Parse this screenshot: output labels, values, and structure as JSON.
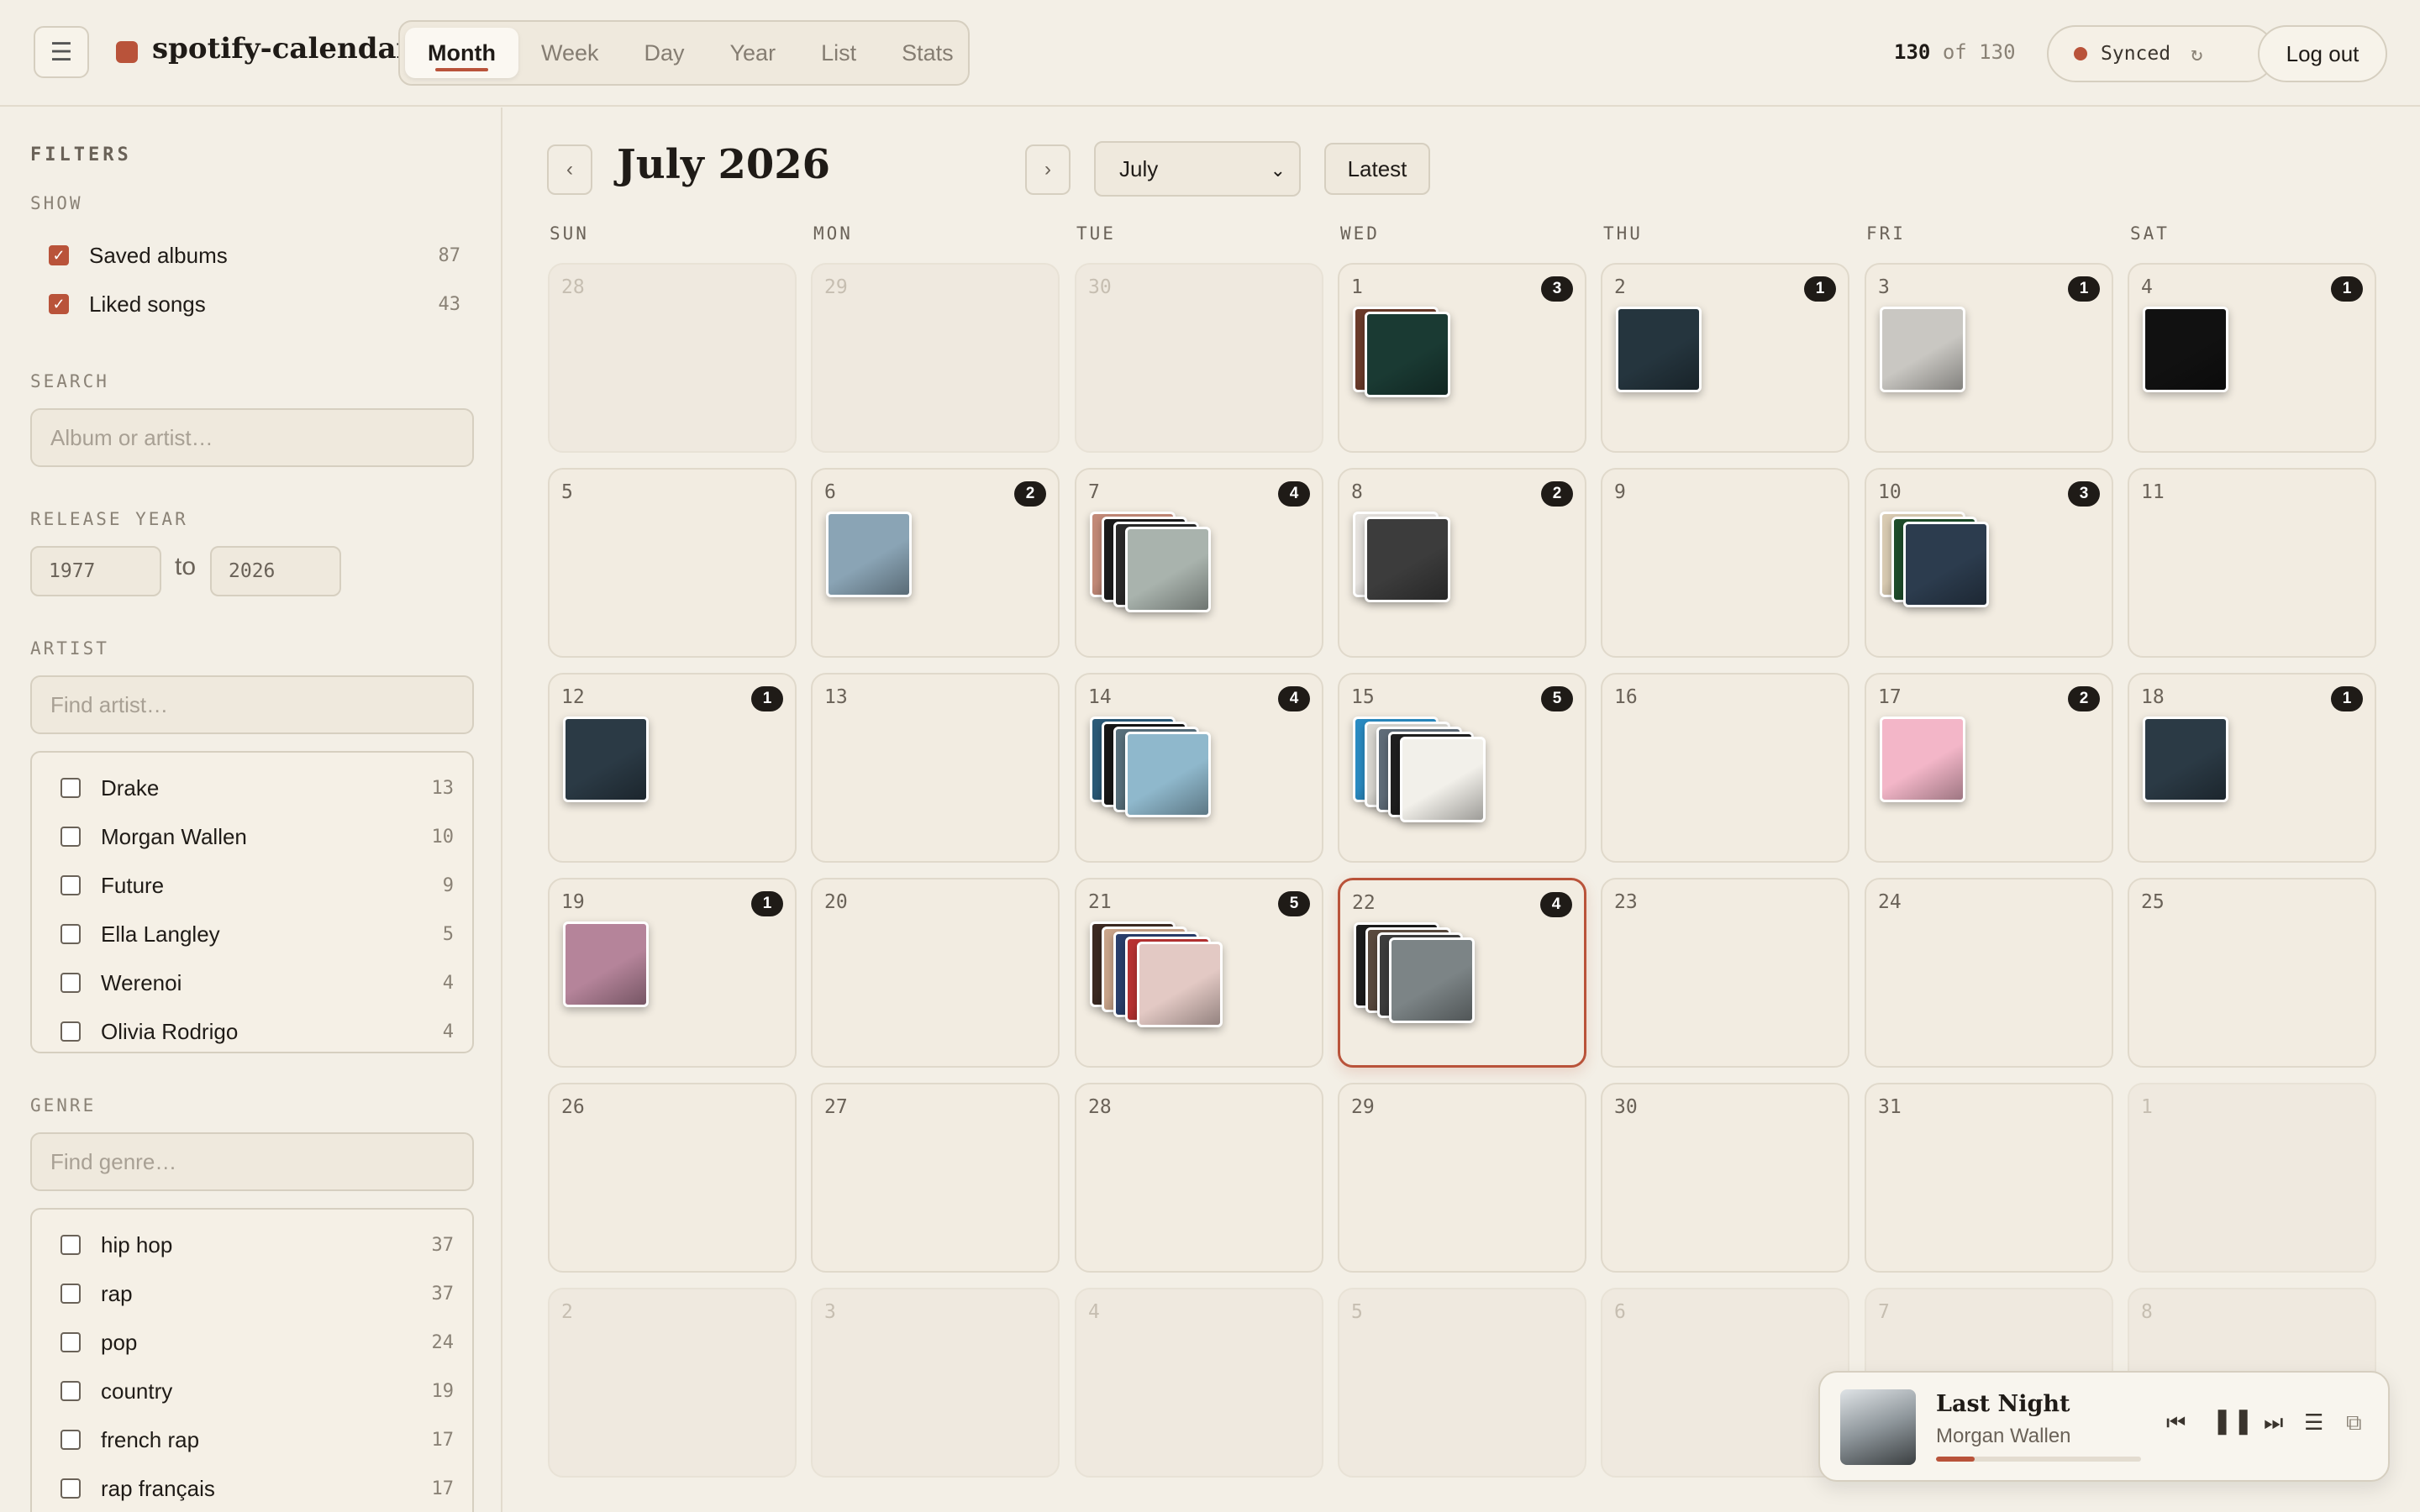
{
  "app": {
    "name": "spotify-calendar"
  },
  "tabs": [
    {
      "label": "Month"
    },
    {
      "label": "Week"
    },
    {
      "label": "Day"
    },
    {
      "label": "Year"
    },
    {
      "label": "List"
    },
    {
      "label": "Stats"
    }
  ],
  "header": {
    "count_shown": "130",
    "count_sep": "of",
    "count_total": "130",
    "sync_label": "Synced",
    "logout_label": "Log out"
  },
  "filters": {
    "title": "FILTERS",
    "show_label": "SHOW",
    "show_items": [
      {
        "label": "Saved albums",
        "count": "87",
        "checked": true
      },
      {
        "label": "Liked songs",
        "count": "43",
        "checked": true
      }
    ],
    "search_label": "SEARCH",
    "search_placeholder": "Album or artist…",
    "year_label": "RELEASE YEAR",
    "year_from": "1977",
    "year_to": "2026",
    "year_sep": "to",
    "artist_label": "ARTIST",
    "artist_placeholder": "Find artist…",
    "artists": [
      {
        "label": "Drake",
        "count": "13"
      },
      {
        "label": "Morgan Wallen",
        "count": "10"
      },
      {
        "label": "Future",
        "count": "9"
      },
      {
        "label": "Ella Langley",
        "count": "5"
      },
      {
        "label": "Werenoi",
        "count": "4"
      },
      {
        "label": "Olivia Rodrigo",
        "count": "4"
      }
    ],
    "genre_label": "GENRE",
    "genre_placeholder": "Find genre…",
    "genres": [
      {
        "label": "hip hop",
        "count": "37"
      },
      {
        "label": "rap",
        "count": "37"
      },
      {
        "label": "pop",
        "count": "24"
      },
      {
        "label": "country",
        "count": "19"
      },
      {
        "label": "french rap",
        "count": "17"
      },
      {
        "label": "rap français",
        "count": "17"
      }
    ]
  },
  "calendar": {
    "title": "July 2026",
    "month_select": "July",
    "latest_label": "Latest",
    "weekdays": [
      "SUN",
      "MON",
      "TUE",
      "WED",
      "THU",
      "FRI",
      "SAT"
    ],
    "days": [
      {
        "n": "28",
        "out": true
      },
      {
        "n": "29",
        "out": true
      },
      {
        "n": "30",
        "out": true
      },
      {
        "n": "1",
        "badge": "3",
        "covers": [
          "#6b3b2a",
          "#1a3a33"
        ]
      },
      {
        "n": "2",
        "badge": "1",
        "covers": [
          "#25353e"
        ]
      },
      {
        "n": "3",
        "badge": "1",
        "covers": [
          "#c9c7c2"
        ]
      },
      {
        "n": "4",
        "badge": "1",
        "covers": [
          "#111111"
        ]
      },
      {
        "n": "5"
      },
      {
        "n": "6",
        "badge": "2",
        "covers": [
          "#8aa4b5"
        ]
      },
      {
        "n": "7",
        "badge": "4",
        "covers": [
          "#c38a78",
          "#1b1b1b",
          "#2a2a2a",
          "#a9b3ad"
        ]
      },
      {
        "n": "8",
        "badge": "2",
        "covers": [
          "#e6e3df",
          "#3c3c3c"
        ]
      },
      {
        "n": "9"
      },
      {
        "n": "10",
        "badge": "3",
        "covers": [
          "#d9cbb2",
          "#1e4d2a",
          "#2c3c4e"
        ]
      },
      {
        "n": "11"
      },
      {
        "n": "12",
        "badge": "1",
        "covers": [
          "#2b3a45"
        ]
      },
      {
        "n": "13"
      },
      {
        "n": "14",
        "badge": "4",
        "covers": [
          "#2b5a78",
          "#161616",
          "#58707c",
          "#8fb8cc"
        ]
      },
      {
        "n": "15",
        "badge": "5",
        "covers": [
          "#2a8bc2",
          "#d8d6d0",
          "#5f6c78",
          "#1f1f1f",
          "#f2f0ea"
        ]
      },
      {
        "n": "16"
      },
      {
        "n": "17",
        "badge": "2",
        "covers": [
          "#f3b6c8"
        ]
      },
      {
        "n": "18",
        "badge": "1",
        "covers": [
          "#2b3a45"
        ]
      },
      {
        "n": "19",
        "badge": "1",
        "covers": [
          "#b5849a"
        ]
      },
      {
        "n": "20"
      },
      {
        "n": "21",
        "badge": "5",
        "covers": [
          "#3c2a22",
          "#c9a48a",
          "#2a3f6c",
          "#b83232",
          "#e3c9c4"
        ]
      },
      {
        "n": "22",
        "badge": "4",
        "selected": true,
        "covers": [
          "#1c1c1c",
          "#5a4a3e",
          "#3d3d3d",
          "#7c8486"
        ]
      },
      {
        "n": "23"
      },
      {
        "n": "24"
      },
      {
        "n": "25"
      },
      {
        "n": "26"
      },
      {
        "n": "27"
      },
      {
        "n": "28"
      },
      {
        "n": "29"
      },
      {
        "n": "30"
      },
      {
        "n": "31"
      },
      {
        "n": "1",
        "out": true
      },
      {
        "n": "2",
        "out": true
      },
      {
        "n": "3",
        "out": true
      },
      {
        "n": "4",
        "out": true
      },
      {
        "n": "5",
        "out": true
      },
      {
        "n": "6",
        "out": true
      },
      {
        "n": "7",
        "out": true
      },
      {
        "n": "8",
        "out": true
      }
    ]
  },
  "player": {
    "track": "Last Night",
    "artist": "Morgan Wallen",
    "progress": 0.19
  },
  "colors": {
    "accent": "#b9533a",
    "background": "#f3efe6",
    "badge": "#1f1b17"
  }
}
